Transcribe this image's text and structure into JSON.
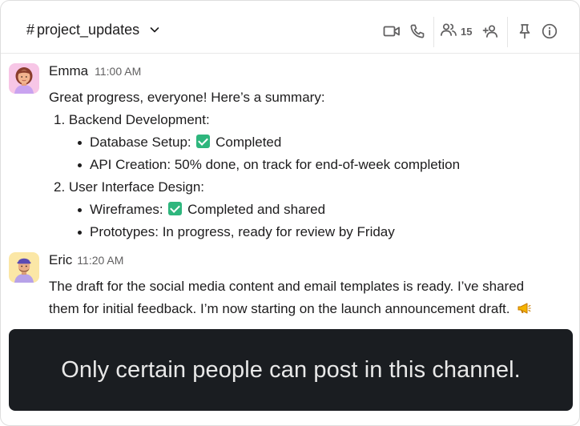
{
  "header": {
    "channel_prefix": "#",
    "channel_name": "project_updates",
    "member_count": "15"
  },
  "messages": [
    {
      "author": "Emma",
      "time": "11:00 AM",
      "avatar": "emma-avatar",
      "lines": {
        "intro": "Great progress, everyone! Here’s a summary:",
        "item1": "1. Backend Development:",
        "item1_a": "Database Setup:",
        "item1_a_status": "Completed",
        "item1_b": "API Creation: 50% done, on track for end-of-week completion",
        "item2": "2. User Interface Design:",
        "item2_a": "Wireframes:",
        "item2_a_status": "Completed and shared",
        "item2_b": "Prototypes: In progress, ready for review by Friday"
      }
    },
    {
      "author": "Eric",
      "time": "11:20 AM",
      "avatar": "eric-avatar",
      "lines": {
        "line1": "The draft for the social media content and email templates is ready. I’ve shared",
        "line2": "them for initial feedback. I’m now starting on the launch announcement draft."
      }
    }
  ],
  "banner": {
    "text": "Only certain people can post in this channel."
  },
  "icons": {
    "check": "white-check-mark-icon",
    "megaphone": "megaphone-icon"
  },
  "colors": {
    "banner_bg": "#1a1d21",
    "check_green": "#2eb67d",
    "icon_gray": "#616061"
  }
}
